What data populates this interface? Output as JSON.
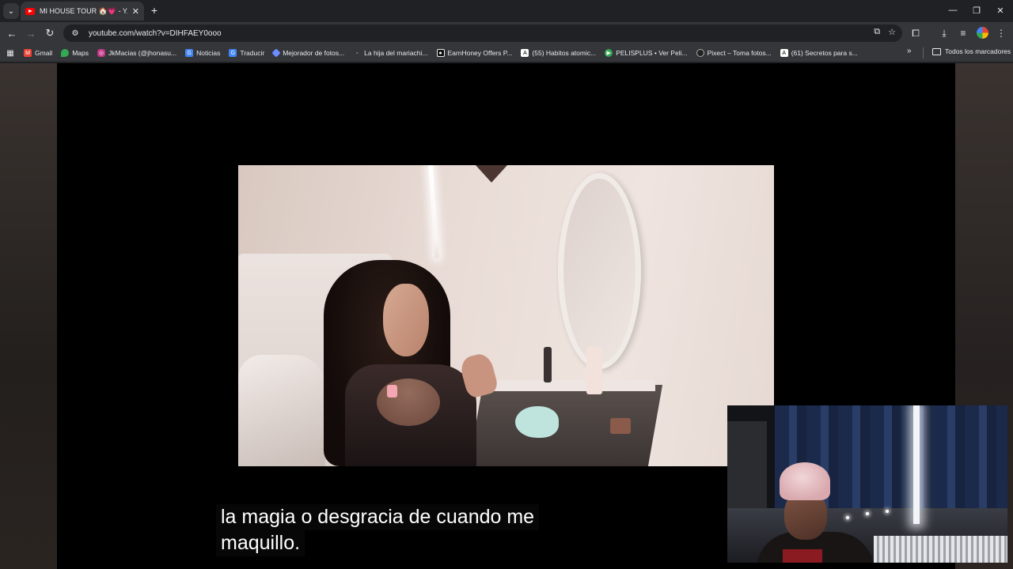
{
  "browser": {
    "tab": {
      "title": "MI HOUSE TOUR 🏠💗 - Y..."
    },
    "url": "youtube.com/watch?v=DIHFAEY0ooo",
    "bookmarks": [
      {
        "label": "Gmail",
        "icon": "gmail-icon",
        "color": "#ea4335"
      },
      {
        "label": "Maps",
        "icon": "maps-icon",
        "color": "#34a853"
      },
      {
        "label": "JkMacias (@jhonasu...",
        "icon": "instagram-icon",
        "color": "#c13584"
      },
      {
        "label": "Noticias",
        "icon": "news-icon",
        "color": "#4285f4"
      },
      {
        "label": "Traducir",
        "icon": "translate-icon",
        "color": "#4285f4"
      },
      {
        "label": "Mejorador de fotos...",
        "icon": "photo-enhancer-icon",
        "color": "#6c8cff"
      },
      {
        "label": "La hija del mariachi...",
        "icon": "page-icon",
        "color": "#5f6368"
      },
      {
        "label": "EarnHoney Offers P...",
        "icon": "earnhoney-icon",
        "color": "#111111"
      },
      {
        "label": "(55) Habitos atomic...",
        "icon": "a-icon",
        "color": "#ffffff"
      },
      {
        "label": "PELISPLUS • Ver Peli...",
        "icon": "pelisplus-icon",
        "color": "#34a853"
      },
      {
        "label": "Pixect – Toma fotos...",
        "icon": "pixect-icon",
        "color": "#222222"
      },
      {
        "label": "(61) Secretos para s...",
        "icon": "a-icon",
        "color": "#ffffff"
      }
    ],
    "all_bookmarks_label": "Todos los marcadores"
  },
  "video": {
    "subtitle_lines": [
      "la magia o desgracia de cuando me",
      "maquillo."
    ]
  },
  "colors": {
    "accent": "#ff0000",
    "chrome_bg": "#35363a"
  }
}
